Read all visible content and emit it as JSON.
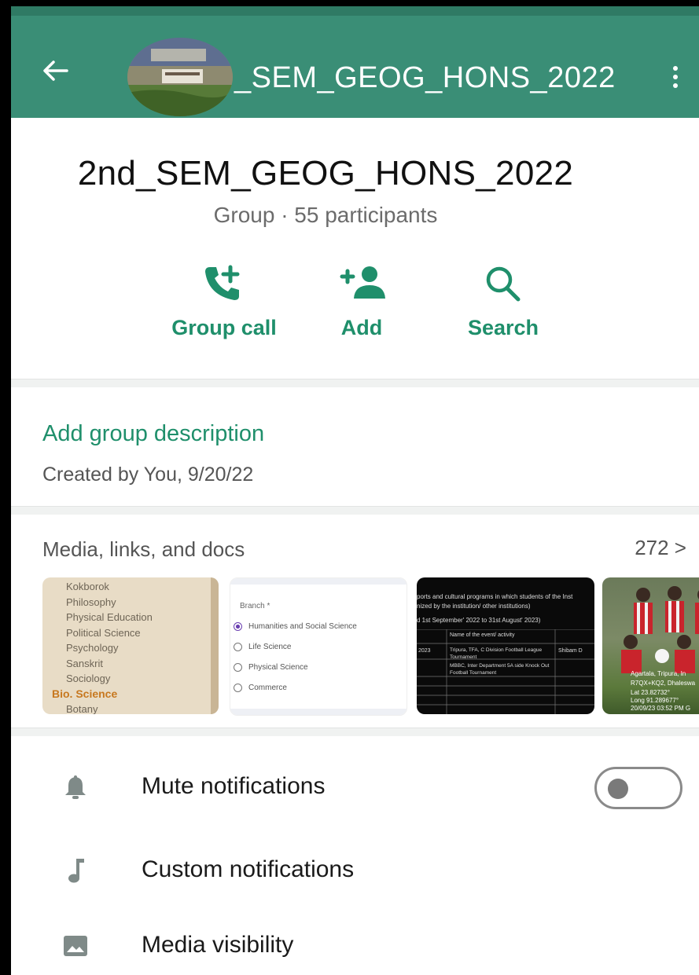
{
  "header": {
    "title": "_SEM_GEOG_HONS_2022",
    "colors": {
      "bar": "#3a8e76",
      "accent": "#1f8f6b"
    }
  },
  "group": {
    "name": "2nd_SEM_GEOG_HONS_2022",
    "meta": "Group · 55 participants"
  },
  "actions": [
    {
      "label": "Group call",
      "icon": "call-add-icon"
    },
    {
      "label": "Add",
      "icon": "person-add-icon"
    },
    {
      "label": "Search",
      "icon": "search-icon"
    }
  ],
  "description": {
    "link": "Add group description",
    "created": "Created by You, 9/20/22"
  },
  "media": {
    "header": "Media, links, and docs",
    "count": "272 >",
    "thumb1": [
      "Kokborok",
      "Philosophy",
      "Physical Education",
      "Political Science",
      "Psychology",
      "Sanskrit",
      "Sociology",
      "Bio. Science",
      "Botany"
    ],
    "thumb2": {
      "caption": "Branch *",
      "options": [
        "Humanities and Social Science",
        "Life Science",
        "Physical Science",
        "Commerce"
      ]
    },
    "thumb3": [
      "ports and cultural programs in which students of the Inst",
      "nized by the institution/ other institutions)",
      "d 1st September' 2022 to 31st August' 2023)",
      "Name of the event/ activity",
      "Tripura, TFA, C Division Football League Tournament",
      "MBBC, Inter Department 5A side Knock Out Football Tournament",
      "Shibam D",
      "2023"
    ],
    "thumb4": [
      "Agartala, Tripura, In",
      "R7QX+KQ2, Dhaleswa",
      "Lat 23.82732°",
      "Long 91.289677°",
      "20/09/23 03:52 PM G"
    ]
  },
  "settings": [
    {
      "label": "Mute notifications",
      "icon": "bell-icon",
      "toggle": false
    },
    {
      "label": "Custom notifications",
      "icon": "music-note-icon"
    },
    {
      "label": "Media visibility",
      "icon": "image-icon"
    }
  ]
}
